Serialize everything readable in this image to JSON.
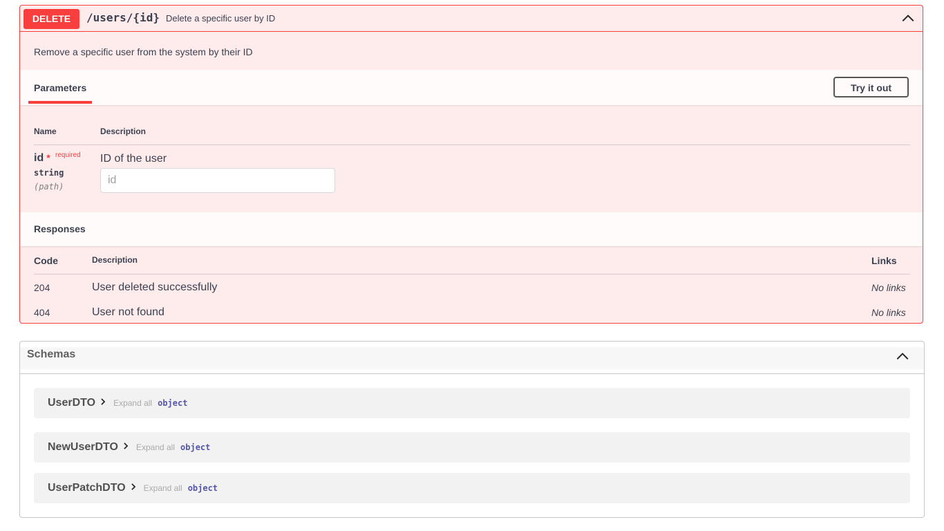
{
  "operation": {
    "method": "DELETE",
    "path": "/users/{id}",
    "summary": "Delete a specific user by ID",
    "description": "Remove a specific user from the system by their ID",
    "color": "#f93e3e"
  },
  "parameters": {
    "tab_label": "Parameters",
    "try_button_label": "Try it out",
    "col_name": "Name",
    "col_description": "Description",
    "items": [
      {
        "name": "id",
        "required_marker": "*",
        "required_label": "required",
        "type": "string",
        "in": "(path)",
        "description": "ID of the user",
        "placeholder": "id"
      }
    ]
  },
  "responses": {
    "title": "Responses",
    "col_code": "Code",
    "col_description": "Description",
    "col_links": "Links",
    "rows": [
      {
        "code": "204",
        "description": "User deleted successfully",
        "links": "No links"
      },
      {
        "code": "404",
        "description": "User not found",
        "links": "No links"
      }
    ]
  },
  "schemas": {
    "title": "Schemas",
    "expand_all_label": "Expand all",
    "models": [
      {
        "name": "UserDTO",
        "type": "object"
      },
      {
        "name": "NewUserDTO",
        "type": "object"
      },
      {
        "name": "UserPatchDTO",
        "type": "object"
      }
    ]
  },
  "icons": {
    "collapse": "chevron-up-icon",
    "model_expand": "chevron-right-icon"
  }
}
